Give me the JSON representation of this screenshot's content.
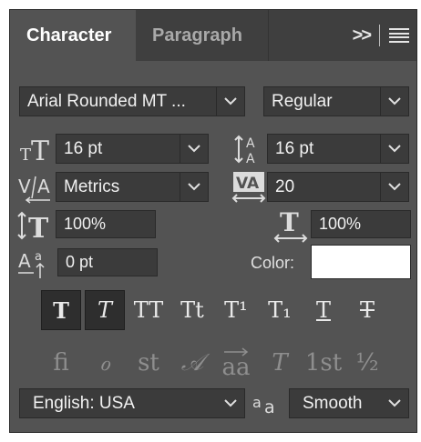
{
  "tabs": {
    "active": "Character",
    "inactive": "Paragraph"
  },
  "font": {
    "family": "Arial Rounded MT ...",
    "style": "Regular"
  },
  "size": {
    "font_size": "16 pt",
    "leading": "16 pt"
  },
  "kerning": {
    "value": "Metrics"
  },
  "tracking": {
    "value": "20"
  },
  "scale": {
    "vertical": "100%",
    "horizontal": "100%"
  },
  "baseline": {
    "value": "0 pt"
  },
  "color": {
    "label": "Color:",
    "value": "#ffffff"
  },
  "style_buttons": [
    "T",
    "T",
    "TT",
    "Tt",
    "T¹",
    "T₁",
    "T",
    "T"
  ],
  "opentype_buttons": [
    "fi",
    "ℴ",
    "st",
    "𝒜",
    "aa",
    "T",
    "1st",
    "½"
  ],
  "language": {
    "value": "English: USA"
  },
  "antialias": {
    "value": "Smooth"
  }
}
